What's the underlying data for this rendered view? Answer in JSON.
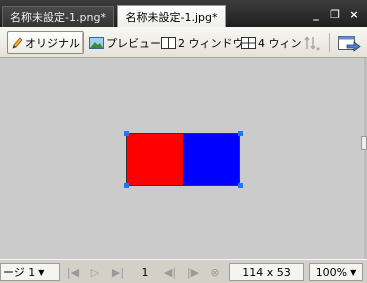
{
  "tabs": [
    {
      "label": "名称未設定-1.png*",
      "active": false
    },
    {
      "label": "名称未設定-1.jpg*",
      "active": true
    }
  ],
  "window_controls": {
    "minimize": "_",
    "restore": "❐",
    "close": "×"
  },
  "toolbar": {
    "original_label": "オリジナル",
    "preview_label": "プレビュー",
    "two_window_label": "2 ウィンドウ",
    "four_window_label": "4 ウィン",
    "icons": {
      "original": "pencil-icon",
      "preview": "picture-icon",
      "two_window": "two-pane-icon",
      "four_window": "four-pane-icon",
      "optimize": "disabled-optimize-icon",
      "export": "export-browser-icon"
    }
  },
  "image": {
    "left_color": "#ff0000",
    "right_color": "#0000ff"
  },
  "status": {
    "page_label": "ージ 1",
    "page_number": "1",
    "dimensions": "114 x 53",
    "zoom": "100%"
  }
}
